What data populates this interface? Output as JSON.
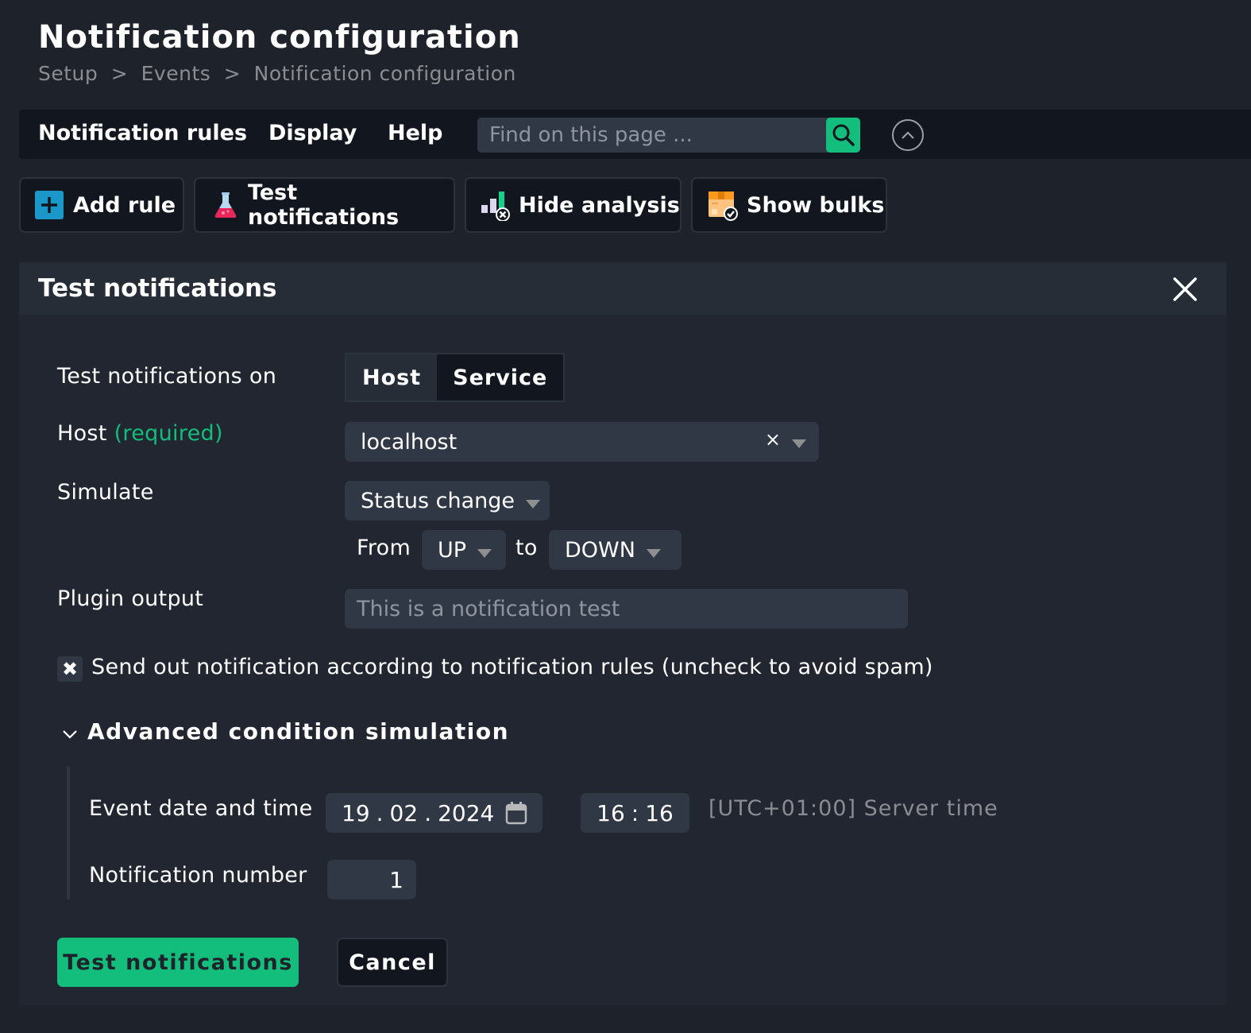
{
  "header": {
    "title": "Notification configuration",
    "breadcrumb": [
      "Setup",
      ">",
      "Events",
      ">",
      "Notification configuration"
    ]
  },
  "menubar": {
    "items": [
      "Notification rules",
      "Display",
      "Help"
    ],
    "search_placeholder": "Find on this page ..."
  },
  "toolbar": {
    "add_rule": "Add rule",
    "test_notifications": "Test notifications",
    "hide_analysis": "Hide analysis",
    "show_bulks": "Show bulks"
  },
  "panel": {
    "title": "Test notifications",
    "test_on_label": "Test notifications on",
    "test_on_options": [
      "Host",
      "Service"
    ],
    "test_on_selected": "Service",
    "host_label": "Host",
    "host_required": "(required)",
    "host_value": "localhost",
    "host_clear": "×",
    "simulate_label": "Simulate",
    "simulate_value": "Status change",
    "from_label": "From",
    "from_value": "UP",
    "to_label": "to",
    "to_value": "DOWN",
    "plugin_output_label": "Plugin output",
    "plugin_output_placeholder": "This is a notification test",
    "send_checkbox_label": "Send out notification according to notification rules (uncheck to avoid spam)",
    "send_checkbox_checked": true,
    "send_checkbox_mark": "✖",
    "advanced_title": "Advanced condition simulation",
    "event_datetime_label": "Event date and time",
    "date_day": "19",
    "date_month": "02",
    "date_year": "2024",
    "date_sep": ".",
    "time_hour": "16",
    "time_minute": "16",
    "time_sep": ":",
    "timezone_note": "[UTC+01:00] Server time",
    "notification_number_label": "Notification number",
    "notification_number_value": "1",
    "submit_label": "Test notifications",
    "cancel_label": "Cancel"
  },
  "colors": {
    "accent": "#13be7d",
    "background": "#1e222a",
    "panel": "#212630",
    "input": "#303845"
  }
}
